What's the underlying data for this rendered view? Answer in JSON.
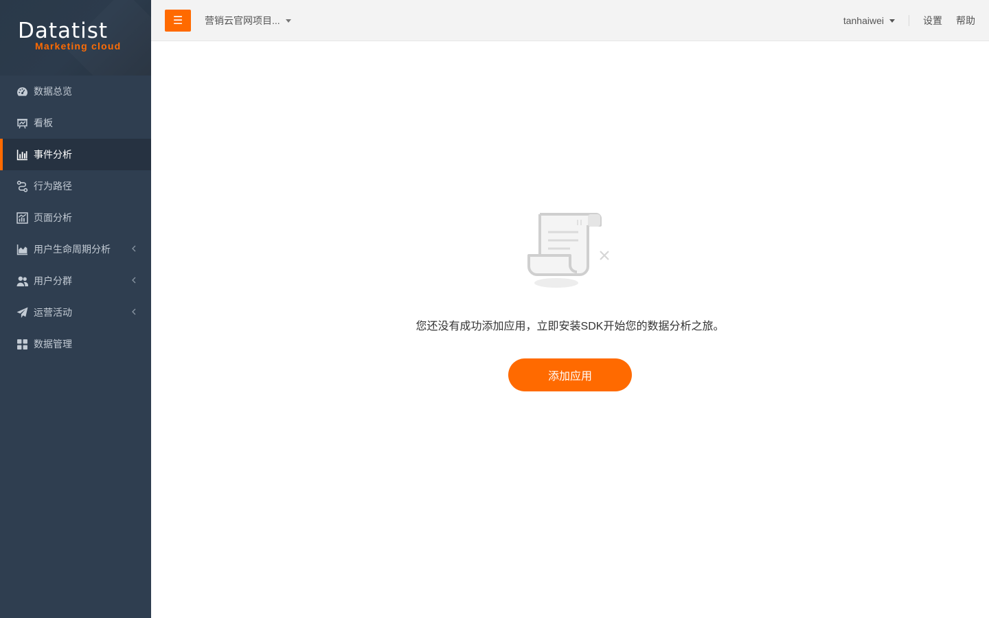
{
  "brand": {
    "name": "Datatist",
    "subtitle": "Marketing cloud"
  },
  "sidebar": {
    "items": [
      {
        "label": "数据总览",
        "icon": "dashboard-icon"
      },
      {
        "label": "看板",
        "icon": "presentation-board-icon"
      },
      {
        "label": "事件分析",
        "icon": "bar-chart-icon",
        "active": true
      },
      {
        "label": "行为路径",
        "icon": "path-icon"
      },
      {
        "label": "页面分析",
        "icon": "area-chart-icon"
      },
      {
        "label": "用户生命周期分析",
        "icon": "line-area-icon",
        "expandable": true
      },
      {
        "label": "用户分群",
        "icon": "users-icon",
        "expandable": true
      },
      {
        "label": "运营活动",
        "icon": "paper-plane-icon",
        "expandable": true
      },
      {
        "label": "数据管理",
        "icon": "grid-icon"
      }
    ]
  },
  "header": {
    "menu_icon": "☰",
    "project": "营销云官网项目...",
    "username": "tanhaiwei",
    "settings": "设置",
    "help": "帮助"
  },
  "main": {
    "empty_message": "您还没有成功添加应用，立即安装SDK开始您的数据分析之旅。",
    "add_button": "添加应用"
  },
  "colors": {
    "accent": "#ff6a00",
    "sidebar_bg": "#2f3e50",
    "sidebar_active": "#263241"
  }
}
